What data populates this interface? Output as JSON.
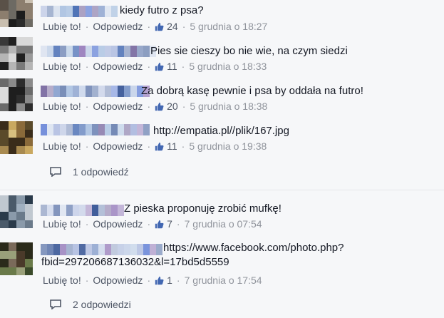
{
  "ui": {
    "like_label": "Lubię to!",
    "reply_label": "Odpowiedz",
    "separator": "·"
  },
  "colors": {
    "link": "#3b5998",
    "meta": "#90949c",
    "action": "#4e5665",
    "like_icon": "#4267b2"
  },
  "comments": [
    {
      "text": "kiedy futro z psa?",
      "likes": "24",
      "time": "5 grudnia o 18:27"
    },
    {
      "text": "Pies sie cieszy bo nie wie, na czym siedzi",
      "likes": "11",
      "time": "5 grudnia o 18:33"
    },
    {
      "text": "Za dobrą kasę pewnie i psa by oddała na futro!",
      "likes": "20",
      "time": "5 grudnia o 18:38"
    },
    {
      "text": "http://empatia.pl//plik/167.jpg",
      "likes": "11",
      "time": "5 grudnia o 19:38"
    },
    {
      "text": "Z pieska proponuję zrobić mufkę!",
      "likes": "7",
      "time": "7 grudnia o 07:54"
    },
    {
      "text_line1": "https://www.facebook.com/photo.php?",
      "text_line2": "fbid=297206687136032&l=17bd5d5559",
      "likes": "1",
      "time": "7 grudnia o 17:54"
    }
  ],
  "reply_links": [
    {
      "label": "1 odpowiedź"
    },
    {
      "label": "2 odpowiedzi"
    }
  ],
  "icons": {
    "like": "thumbs-up-icon",
    "reply": "speech-bubble-icon"
  }
}
